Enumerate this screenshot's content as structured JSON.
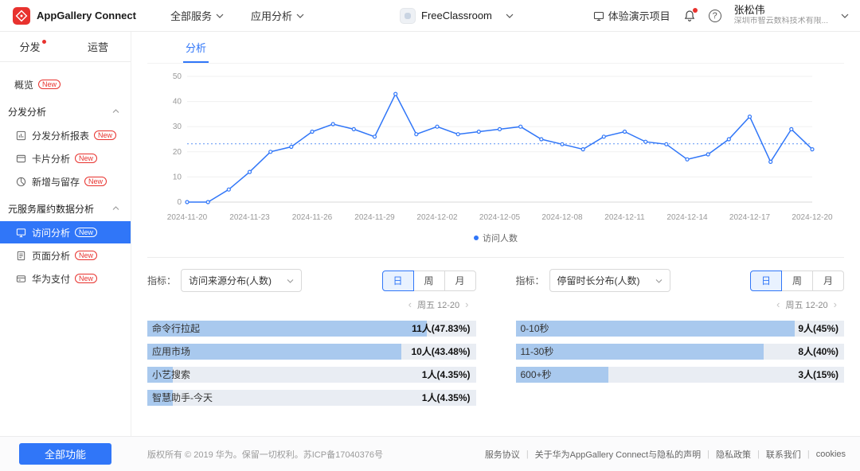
{
  "colors": {
    "accent": "#3076f8",
    "badge_red": "#e8322e",
    "chart_line": "#3076f8",
    "bar_fill": "#a9c9ee",
    "bar_track": "#e9edf3"
  },
  "header": {
    "brand": "AppGallery Connect",
    "nav": [
      {
        "key": "all-services",
        "label": "全部服务"
      },
      {
        "key": "app-analysis",
        "label": "应用分析"
      }
    ],
    "app_selector": {
      "label": "FreeClassroom"
    },
    "demo_project": "体验演示项目",
    "user": {
      "name": "张松伟",
      "org": "深圳市智云数科技术有限..."
    }
  },
  "sidebar": {
    "tabs": [
      {
        "key": "distribution",
        "label": "分发",
        "dot": true
      },
      {
        "key": "operation",
        "label": "运营",
        "dot": false
      }
    ],
    "items": [
      {
        "type": "item",
        "key": "overview",
        "label": "概览",
        "badge": "New"
      },
      {
        "type": "section",
        "key": "distribution-analysis",
        "label": "分发分析"
      },
      {
        "type": "item",
        "key": "distribution-report",
        "label": "分发分析报表",
        "badge": "New",
        "icon": "report-icon",
        "indent": true
      },
      {
        "type": "item",
        "key": "card-analysis",
        "label": "卡片分析",
        "badge": "New",
        "icon": "card-icon",
        "indent": true
      },
      {
        "type": "item",
        "key": "new-and-retention",
        "label": "新增与留存",
        "badge": "New",
        "icon": "retention-icon",
        "indent": true
      },
      {
        "type": "section",
        "key": "meta-service-data",
        "label": "元服务履约数据分析"
      },
      {
        "type": "item",
        "key": "visit-analysis",
        "label": "访问分析",
        "badge": "New",
        "icon": "visit-icon",
        "indent": true,
        "active": true
      },
      {
        "type": "item",
        "key": "page-analysis",
        "label": "页面分析",
        "badge": "New",
        "icon": "page-icon",
        "indent": true
      },
      {
        "type": "item",
        "key": "huawei-pay",
        "label": "华为支付",
        "badge": "New",
        "icon": "pay-icon",
        "indent": true
      }
    ],
    "all_features_button": "全部功能"
  },
  "main": {
    "tab": "分析",
    "chart_data": {
      "type": "line",
      "title": "",
      "legend_position": "bottom",
      "grid": true,
      "ylim": [
        0,
        50
      ],
      "yticks": [
        0,
        10,
        20,
        30,
        40,
        50
      ],
      "x": [
        "2024-11-20",
        "2024-11-21",
        "2024-11-22",
        "2024-11-23",
        "2024-11-24",
        "2024-11-25",
        "2024-11-26",
        "2024-11-27",
        "2024-11-28",
        "2024-11-29",
        "2024-11-30",
        "2024-12-01",
        "2024-12-02",
        "2024-12-03",
        "2024-12-04",
        "2024-12-05",
        "2024-12-06",
        "2024-12-07",
        "2024-12-08",
        "2024-12-09",
        "2024-12-10",
        "2024-12-11",
        "2024-12-12",
        "2024-12-13",
        "2024-12-14",
        "2024-12-15",
        "2024-12-16",
        "2024-12-17",
        "2024-12-18",
        "2024-12-19",
        "2024-12-20"
      ],
      "xtick_labels": [
        "2024-11-20",
        "2024-11-23",
        "2024-11-26",
        "2024-11-29",
        "2024-12-02",
        "2024-12-05",
        "2024-12-08",
        "2024-12-11",
        "2024-12-14",
        "2024-12-17",
        "2024-12-20"
      ],
      "series": [
        {
          "name": "访问人数",
          "values": [
            0,
            0,
            5,
            12,
            20,
            22,
            28,
            31,
            29,
            26,
            43,
            27,
            30,
            27,
            28,
            29,
            30,
            25,
            23,
            21,
            26,
            28,
            24,
            23,
            17,
            19,
            25,
            34,
            16,
            29,
            21
          ]
        }
      ],
      "avg_reference_line": 23.2
    },
    "panels": [
      {
        "key": "visit-source",
        "metric_label": "指标：",
        "select_value": "访问来源分布(人数)",
        "period_options": [
          "日",
          "周",
          "月"
        ],
        "active_period": "日",
        "date_nav": "周五 12-20",
        "bars": [
          {
            "label": "命令行拉起",
            "count": 11,
            "value": "11人(47.83%)"
          },
          {
            "label": "应用市场",
            "count": 10,
            "value": "10人(43.48%)"
          },
          {
            "label": "小艺搜索",
            "count": 1,
            "value": "1人(4.35%)"
          },
          {
            "label": "智慧助手-今天",
            "count": 1,
            "value": "1人(4.35%)"
          }
        ]
      },
      {
        "key": "stay-duration",
        "metric_label": "指标：",
        "select_value": "停留时长分布(人数)",
        "period_options": [
          "日",
          "周",
          "月"
        ],
        "active_period": "日",
        "date_nav": "周五 12-20",
        "bars": [
          {
            "label": "0-10秒",
            "count": 9,
            "value": "9人(45%)"
          },
          {
            "label": "11-30秒",
            "count": 8,
            "value": "8人(40%)"
          },
          {
            "label": "600+秒",
            "count": 3,
            "value": "3人(15%)"
          }
        ]
      }
    ]
  },
  "footer": {
    "copyright": "版权所有 © 2019 华为。保留一切权利。苏ICP备17040376号",
    "links": [
      "服务协议",
      "关于华为AppGallery Connect与隐私的声明",
      "隐私政策",
      "联系我们",
      "cookies"
    ]
  }
}
